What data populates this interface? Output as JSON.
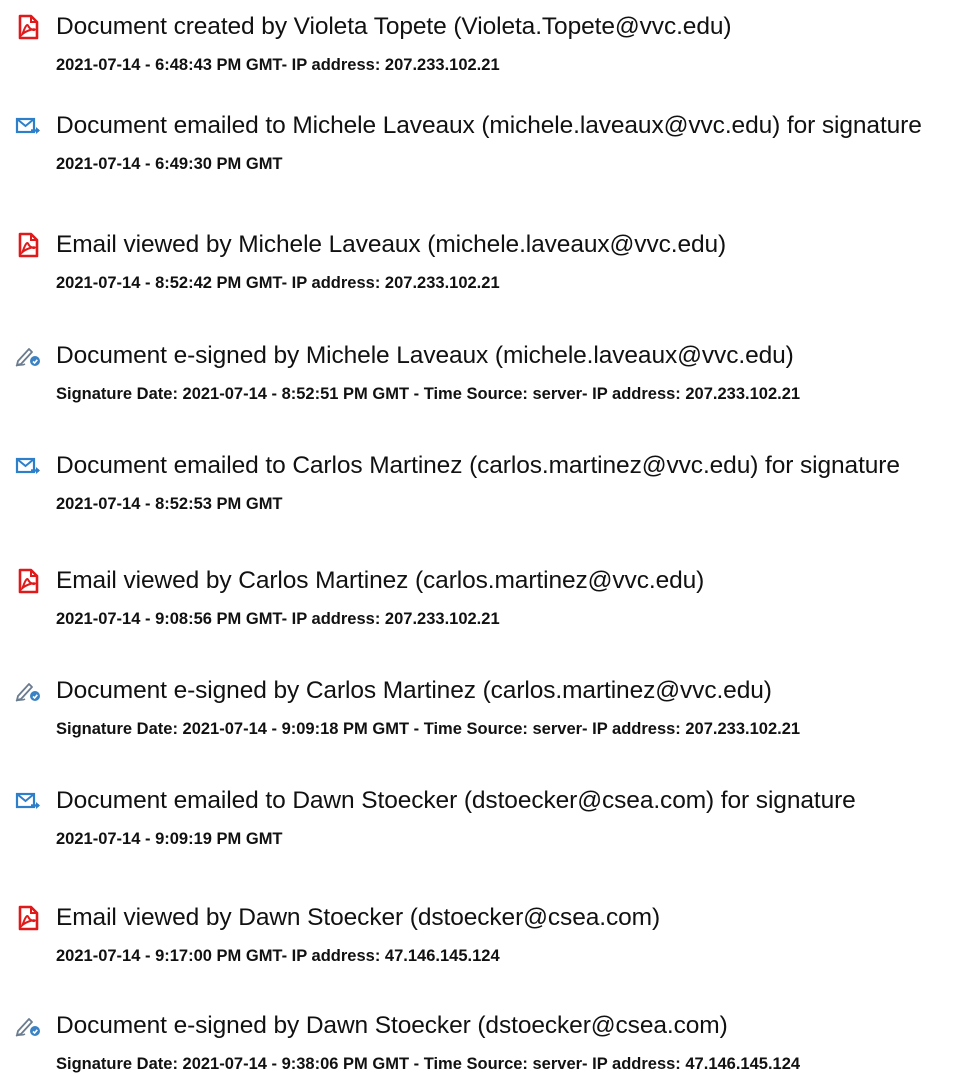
{
  "colors": {
    "pdf_icon": "#e01a1a",
    "email_icon": "#2d7fc9",
    "sign_icon": "#3a82c4",
    "text": "#111111"
  },
  "events": [
    {
      "icon": "pdf-document-icon",
      "title": "Document created by Violeta Topete (Violeta.Topete@vvc.edu)",
      "meta": "2021-07-14 - 6:48:43 PM GMT- IP address: 207.233.102.21"
    },
    {
      "icon": "email-send-icon",
      "title": "Document emailed to Michele Laveaux (michele.laveaux@vvc.edu) for signature",
      "meta": "2021-07-14 - 6:49:30 PM GMT"
    },
    {
      "icon": "pdf-document-icon",
      "title": "Email viewed by Michele Laveaux (michele.laveaux@vvc.edu)",
      "meta": "2021-07-14 - 8:52:42 PM GMT- IP address: 207.233.102.21"
    },
    {
      "icon": "e-sign-pen-icon",
      "title": "Document e-signed by Michele Laveaux (michele.laveaux@vvc.edu)",
      "meta": "Signature Date: 2021-07-14 - 8:52:51 PM GMT - Time Source: server- IP address: 207.233.102.21"
    },
    {
      "icon": "email-send-icon",
      "title": "Document emailed to Carlos Martinez (carlos.martinez@vvc.edu) for signature",
      "meta": "2021-07-14 - 8:52:53 PM GMT"
    },
    {
      "icon": "pdf-document-icon",
      "title": "Email viewed by Carlos Martinez (carlos.martinez@vvc.edu)",
      "meta": "2021-07-14 - 9:08:56 PM GMT- IP address: 207.233.102.21"
    },
    {
      "icon": "e-sign-pen-icon",
      "title": "Document e-signed by Carlos Martinez (carlos.martinez@vvc.edu)",
      "meta": "Signature Date: 2021-07-14 - 9:09:18 PM GMT - Time Source: server- IP address: 207.233.102.21"
    },
    {
      "icon": "email-send-icon",
      "title": "Document emailed to Dawn Stoecker (dstoecker@csea.com) for signature",
      "meta": "2021-07-14 - 9:09:19 PM GMT"
    },
    {
      "icon": "pdf-document-icon",
      "title": "Email viewed by Dawn Stoecker (dstoecker@csea.com)",
      "meta": "2021-07-14 - 9:17:00 PM GMT- IP address: 47.146.145.124"
    },
    {
      "icon": "e-sign-pen-icon",
      "title": "Document e-signed by Dawn Stoecker (dstoecker@csea.com)",
      "meta": "Signature Date: 2021-07-14 - 9:38:06 PM GMT - Time Source: server- IP address: 47.146.145.124"
    }
  ]
}
